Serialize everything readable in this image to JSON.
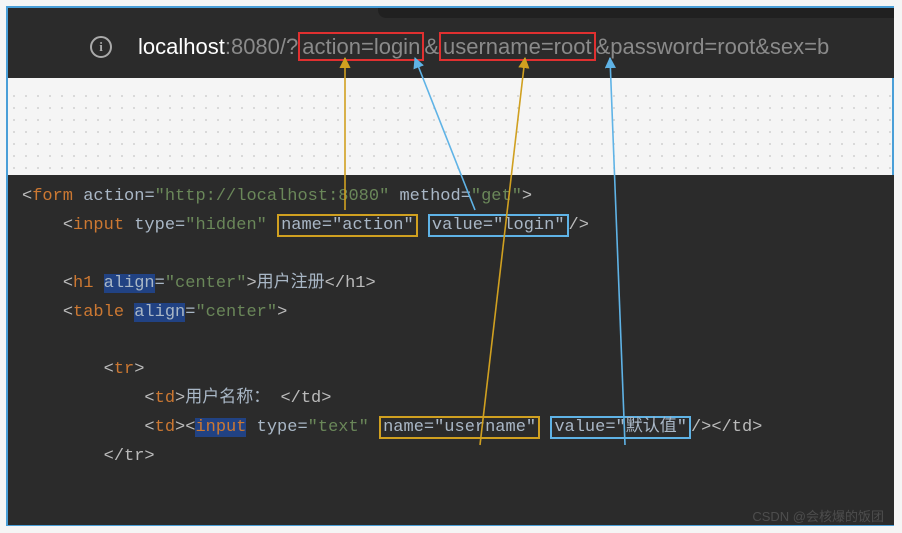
{
  "url": {
    "host": "localhost",
    "port": ":8080",
    "path": "/?",
    "seg1": "action=login",
    "amp1": "&",
    "seg2": "username=root",
    "amp2": "&",
    "rest": "password=root&sex=b"
  },
  "info_icon": "i",
  "code": {
    "l1": {
      "open": "<",
      "tag": "form",
      "sp": " ",
      "a1": "action",
      "eq": "=",
      "v1": "\"http://localhost:8080\"",
      "sp2": " ",
      "a2": "method",
      "v2": "\"get\"",
      "close": ">"
    },
    "l2": {
      "open": "<",
      "tag": "input",
      "sp": " ",
      "a1": "type",
      "v1": "\"hidden\"",
      "sp2": " ",
      "box_y": "name=\"action\"",
      "sp3": " ",
      "box_b": "value=\"login\"",
      "end": "/>"
    },
    "l4": {
      "open": "<",
      "tag": "h1",
      "sp": " ",
      "attr_sel": "align",
      "eq": "=",
      "v": "\"center\"",
      "close": ">",
      "text": "用户注册",
      "ctag": "</h1>"
    },
    "l5": {
      "open": "<",
      "tag": "table",
      "sp": " ",
      "attr_sel": "align",
      "eq": "=",
      "v": "\"center\"",
      "close": ">"
    },
    "l7": {
      "open": "<",
      "tag": "tr",
      "close": ">"
    },
    "l8": {
      "open": "<",
      "tag": "td",
      "close": ">",
      "text": "用户名称：",
      "sp": " ",
      "ctag": "</td>"
    },
    "l9": {
      "open": "<",
      "tag": "td",
      "close": ">",
      "iopen": "<",
      "itag_sel": "input",
      "isp": " ",
      "a1": "type",
      "v1": "\"text\"",
      "sp2": " ",
      "box_y": "name=\"username\"",
      "sp3": " ",
      "box_b": "value=\"默认值\"",
      "iend": "/>",
      "ctag": "</td>"
    },
    "l10": {
      "ctag": "</tr>"
    }
  },
  "watermark": "CSDN @会核爆的饭团"
}
